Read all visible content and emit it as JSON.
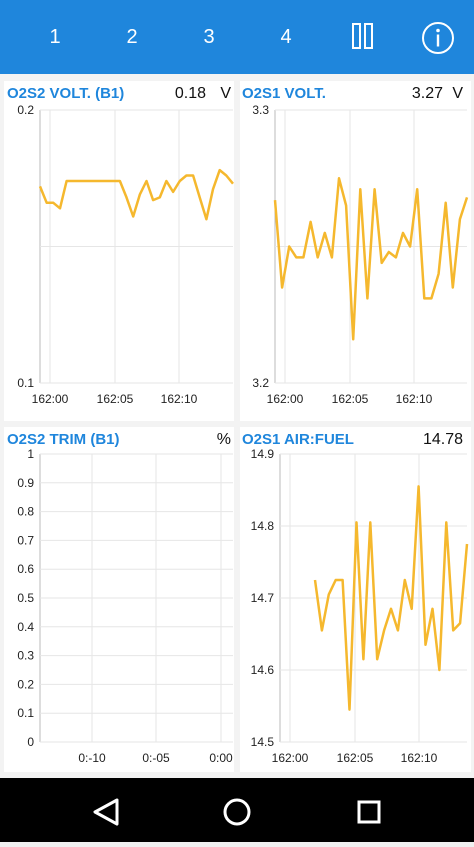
{
  "toolbar": {
    "tabs": [
      "1",
      "2",
      "3",
      "4"
    ],
    "pause_icon": "pause-icon",
    "info_icon": "info-icon",
    "color": "#1f86dc"
  },
  "panels": [
    {
      "title": "O2S2 VOLT. (B1)",
      "value": "0.18",
      "unit": "V"
    },
    {
      "title": "O2S1 VOLT.",
      "value": "3.27",
      "unit": "V"
    },
    {
      "title": "O2S2 TRIM (B1)",
      "value": "",
      "unit": "%"
    },
    {
      "title": "O2S1 AIR:FUEL",
      "value": "14.78",
      "unit": ""
    }
  ],
  "chart_data": [
    {
      "type": "line",
      "line_color": "#f5b82e",
      "y_ticks": [
        "0.2",
        "0.1"
      ],
      "x_ticks": [
        "162:00",
        "162:05",
        "162:10"
      ],
      "ylim": [
        0.1,
        0.2
      ],
      "grid": true,
      "series": [
        {
          "y": [
            0.172,
            0.166,
            0.166,
            0.164,
            0.174,
            0.174,
            0.174,
            0.174,
            0.174,
            0.174,
            0.174,
            0.174,
            0.174,
            0.168,
            0.161,
            0.169,
            0.174,
            0.167,
            0.168,
            0.174,
            0.17,
            0.174,
            0.176,
            0.176,
            0.168,
            0.16,
            0.171,
            0.178,
            0.176,
            0.173
          ]
        }
      ]
    },
    {
      "type": "line",
      "line_color": "#f5b82e",
      "y_ticks": [
        "3.3",
        "3.2"
      ],
      "x_ticks": [
        "162:00",
        "162:05",
        "162:10"
      ],
      "ylim": [
        3.2,
        3.3
      ],
      "grid": true,
      "series": [
        {
          "y": [
            3.267,
            3.235,
            3.25,
            3.246,
            3.246,
            3.259,
            3.246,
            3.255,
            3.246,
            3.275,
            3.265,
            3.216,
            3.271,
            3.231,
            3.271,
            3.244,
            3.248,
            3.246,
            3.255,
            3.25,
            3.271,
            3.231,
            3.231,
            3.24,
            3.266,
            3.235,
            3.26,
            3.268
          ]
        }
      ]
    },
    {
      "type": "line",
      "line_color": "#f5b82e",
      "y_ticks": [
        "1",
        "0.9",
        "0.8",
        "0.7",
        "0.6",
        "0.5",
        "0.4",
        "0.3",
        "0.2",
        "0.1",
        "0"
      ],
      "x_ticks": [
        "0:-10",
        "0:-05",
        "0:00"
      ],
      "ylim": [
        0,
        1
      ],
      "grid": true,
      "series": [
        {
          "y": []
        }
      ]
    },
    {
      "type": "line",
      "line_color": "#f5b82e",
      "y_ticks": [
        "14.9",
        "14.8",
        "14.7",
        "14.6",
        "14.5"
      ],
      "x_ticks": [
        "162:00",
        "162:05",
        "162:10"
      ],
      "ylim": [
        14.5,
        14.9
      ],
      "grid": true,
      "series": [
        {
          "y": [
            14.725,
            14.655,
            14.705,
            14.725,
            14.725,
            14.545,
            14.805,
            14.615,
            14.805,
            14.615,
            14.655,
            14.685,
            14.655,
            14.725,
            14.685,
            14.855,
            14.635,
            14.685,
            14.6,
            14.805,
            14.655,
            14.665,
            14.775
          ]
        }
      ]
    }
  ],
  "nav": {
    "back_icon": "back-triangle-icon",
    "home_icon": "home-circle-icon",
    "recents_icon": "recents-square-icon"
  }
}
